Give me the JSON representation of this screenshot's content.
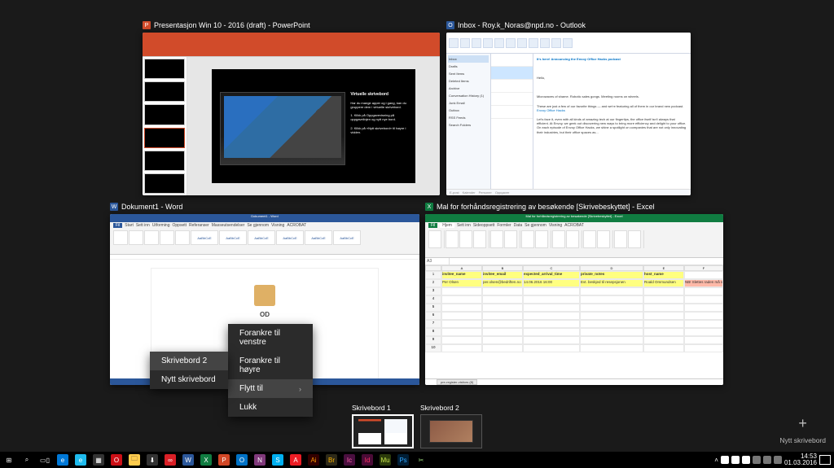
{
  "windows": {
    "powerpoint": {
      "title": "Presentasjon Win 10 - 2016 (draft) - PowerPoint",
      "slide_title": "Virtuelle skrivebord",
      "slide_text": "Har du mange apper og i gang, kan du gruppere dem i virtuelle skrivebord.\n\n1. Klikk på Oppgavevisning på oppgavelinjen og nytt nye bord.\n\n2. Klikk på «Nytt skrivebord» til høyre i vidden."
    },
    "outlook": {
      "title": "Inbox - Roy.k_Noras@npd.no - Outlook",
      "nav": [
        "Inbox",
        "Drafts",
        "Sent Items",
        "Deleted Items",
        "Archive",
        "Conversation History (1)",
        "Junk Email",
        "Outbox",
        "RSS Feeds",
        "Search Folders"
      ],
      "reading_subject": "It's here! Announcing the Envoy Office Hacks podcast",
      "reading_sender": "Hello,",
      "reading_body_1": "Microwaves of shame. Robotic sales gongs. Meeting rooms on wheels.",
      "reading_body_2": "These are just a few of our favorite things — and we're featuring all of them in our brand new podcast.",
      "reading_body_3": "Let's face it, even with all kinds of amazing tech at our fingertips, the office itself isn't always that efficient. At Envoy, we geek out discovering new ways to bring more efficiency and delight to your office. On each episode of Envoy Office Hacks, we shine a spotlight on companies that are not only innovating their industries, but their office spaces as...",
      "reading_link": "Envoy Office Hacks",
      "footer_items": [
        "E-post",
        "Kalender",
        "Personer",
        "Oppgaver"
      ]
    },
    "word": {
      "title": "Dokument1 - Word",
      "tabs": [
        "Fil",
        "Start",
        "Sett inn",
        "Utforming",
        "Oppsett",
        "Referanser",
        "Masseutsendelser",
        "Se gjennom",
        "Visning",
        "ACROBAT"
      ],
      "styles": [
        "AaBbCcE",
        "AaBbCcE",
        "AaBbCcE",
        "AaBbCcE",
        "AaBbCcE",
        "AaBbCcE"
      ],
      "od_text": "OD"
    },
    "excel": {
      "title": "Mal for forhåndsregistrering av besøkende  [Skrivebeskyttet] - Excel",
      "inner_title": "Mal for forhåndsregistrering av besøkende  [Skrivebeskyttet] - Excel",
      "tabs": [
        "Fil",
        "Hjem",
        "Sett inn",
        "Sideoppsett",
        "Formler",
        "Data",
        "Se gjennom",
        "Visning",
        "ACROBAT"
      ],
      "columns": [
        "",
        "A",
        "B",
        "C",
        "D",
        "E",
        "F"
      ],
      "header_row": [
        "1",
        "invitee_name",
        "invitee_email",
        "expected_arrival_time",
        "private_notes",
        "host_name",
        ""
      ],
      "data_row": [
        "2",
        "Per Olsen",
        "per.olsen@bedriften.no",
        "14.06.2016 16:00",
        "Evt. beskjed til resepsjonen",
        "Roald Ommundsen",
        "NB! Slettes raden må slettes"
      ],
      "sheet_tab": "pre-register-visitors (8)",
      "cell_ref": "A3"
    }
  },
  "context_menu": {
    "items": [
      "Forankre til venstre",
      "Forankre til høyre",
      "Flytt til",
      "Lukk"
    ],
    "submenu": {
      "items": [
        "Skrivebord 2",
        "Nytt skrivebord"
      ]
    }
  },
  "desktops": {
    "items": [
      "Skrivebord 1",
      "Skrivebord 2"
    ],
    "new_label": "Nytt skrivebord"
  },
  "taskbar": {
    "apps": [
      {
        "name": "start",
        "glyph": "⊞",
        "bg": "transparent",
        "color": "#fff"
      },
      {
        "name": "search",
        "glyph": "⌕",
        "bg": "transparent",
        "color": "#fff"
      },
      {
        "name": "task-view",
        "glyph": "▭▯",
        "bg": "transparent",
        "color": "#fff"
      },
      {
        "name": "edge",
        "glyph": "e",
        "bg": "#0078d7",
        "color": "#fff"
      },
      {
        "name": "ie",
        "glyph": "e",
        "bg": "#1ebbee",
        "color": "#fff"
      },
      {
        "name": "calculator",
        "glyph": "▦",
        "bg": "#333",
        "color": "#fff"
      },
      {
        "name": "opera",
        "glyph": "O",
        "bg": "#cc0f16",
        "color": "#fff"
      },
      {
        "name": "explorer",
        "glyph": "🗀",
        "bg": "#ffcc4d",
        "color": "#333"
      },
      {
        "name": "store",
        "glyph": "⬇",
        "bg": "#333",
        "color": "#fff"
      },
      {
        "name": "creative-cloud",
        "glyph": "∞",
        "bg": "#da1f26",
        "color": "#fff"
      },
      {
        "name": "word",
        "glyph": "W",
        "bg": "#2b579a",
        "color": "#fff"
      },
      {
        "name": "excel",
        "glyph": "X",
        "bg": "#107c41",
        "color": "#fff"
      },
      {
        "name": "powerpoint",
        "glyph": "P",
        "bg": "#d24726",
        "color": "#fff"
      },
      {
        "name": "outlook",
        "glyph": "O",
        "bg": "#0072c6",
        "color": "#fff"
      },
      {
        "name": "onenote",
        "glyph": "N",
        "bg": "#80397b",
        "color": "#fff"
      },
      {
        "name": "skype",
        "glyph": "S",
        "bg": "#00aff0",
        "color": "#fff"
      },
      {
        "name": "acrobat",
        "glyph": "A",
        "bg": "#ec1c24",
        "color": "#fff"
      },
      {
        "name": "illustrator",
        "glyph": "Ai",
        "bg": "#330000",
        "color": "#ff9a00"
      },
      {
        "name": "bridge",
        "glyph": "Br",
        "bg": "#2e2a19",
        "color": "#ffb500"
      },
      {
        "name": "incopy",
        "glyph": "Ic",
        "bg": "#4a0f3f",
        "color": "#ff63ab"
      },
      {
        "name": "indesign",
        "glyph": "Id",
        "bg": "#4b0b36",
        "color": "#ff3366"
      },
      {
        "name": "muse",
        "glyph": "Mu",
        "bg": "#2b3b0b",
        "color": "#c8e64c"
      },
      {
        "name": "photoshop",
        "glyph": "Ps",
        "bg": "#001e36",
        "color": "#31a8ff"
      },
      {
        "name": "snipping",
        "glyph": "✂",
        "bg": "transparent",
        "color": "#9fe07f"
      }
    ],
    "clock_time": "14:53",
    "clock_date": "01.03.2016"
  }
}
